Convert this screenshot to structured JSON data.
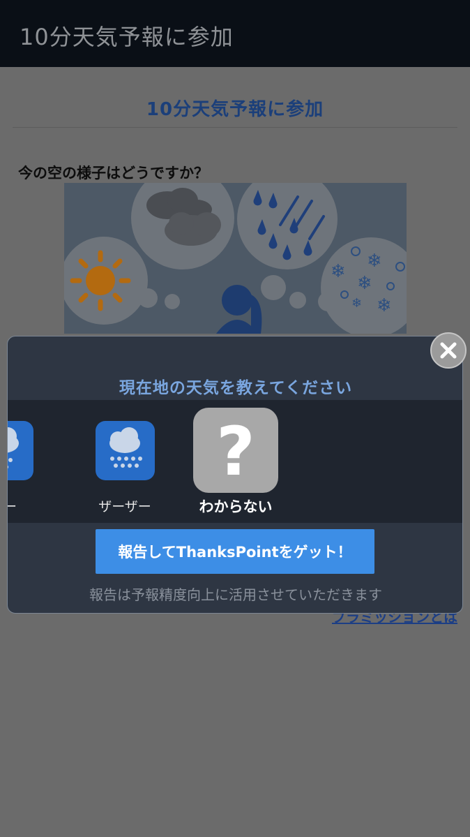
{
  "appbar": {
    "title": "10分天気予報に参加"
  },
  "page": {
    "title": "10分天気予報に参加",
    "question": "今の空の様子はどうですか？",
    "illustration_caption": "",
    "permission_link": "ブラミッションとは"
  },
  "modal": {
    "title": "現在地の天気を教えてください",
    "options": [
      {
        "label": "ナー",
        "icon": "rain-icon"
      },
      {
        "label": "ザーザー",
        "icon": "heavy-rain-icon"
      },
      {
        "label": "わからない",
        "icon": "question-icon"
      }
    ],
    "report_button": "報告してThanksPointをゲット！",
    "note": "報告は予報精度向上に活用させていただきます",
    "close_icon": "close-icon"
  },
  "colors": {
    "appbar": "#0a0f16",
    "accent_title": "#7aa6df",
    "button": "#3d8ee6",
    "weather_icon_bg": "#276cc7",
    "unknown_icon_bg": "#a8a8a8"
  }
}
